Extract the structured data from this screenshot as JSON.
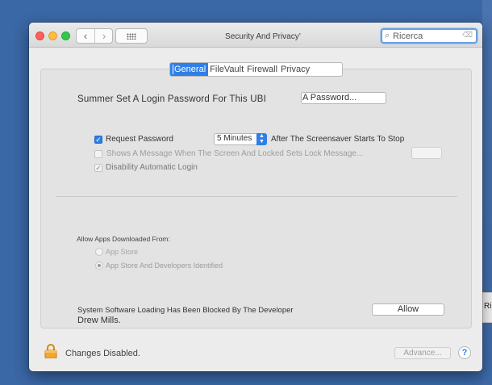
{
  "window": {
    "title": "Security And Privacy’"
  },
  "toolbar": {
    "back_icon": "‹",
    "forward_icon": "›",
    "search_placeholder": "Ricerca"
  },
  "tabs": [
    {
      "label": "General",
      "selected": true
    },
    {
      "label": "FileVault",
      "selected": false
    },
    {
      "label": "Firewall",
      "selected": false
    },
    {
      "label": "Privacy",
      "selected": false
    }
  ],
  "general": {
    "password_label": "Summer Set A Login Password For This UBI",
    "password_button": "A Password...",
    "require_password": {
      "checked": true,
      "label": "Request Password",
      "popup_value": "5 Minutes",
      "after_label": "After The Screensaver Starts To Stop"
    },
    "show_message": {
      "checked": false,
      "label": "Shows A Message When The Screen And Locked Sets Lock Message..."
    },
    "disable_login": {
      "checked": true,
      "label": "Disability Automatic Login"
    }
  },
  "allow_apps": {
    "title": "Allow Apps Downloaded From:",
    "options": [
      {
        "label": "App Store",
        "selected": false
      },
      {
        "label": "App Store And Developers Identified",
        "selected": true
      }
    ]
  },
  "blocked": {
    "message": "System Software Loading Has Been Blocked By The Developer",
    "developer": "Drew Mills.",
    "allow_button": "Allow"
  },
  "footer": {
    "lock_text": "Changes Disabled.",
    "advanced_button": "Advance...",
    "help_label": "?"
  },
  "desktop": {
    "right_peek_text": "Ri"
  },
  "colors": {
    "accent": "#2f7fe8",
    "desktop": "#3a67a5",
    "window_bg": "#ececec"
  }
}
